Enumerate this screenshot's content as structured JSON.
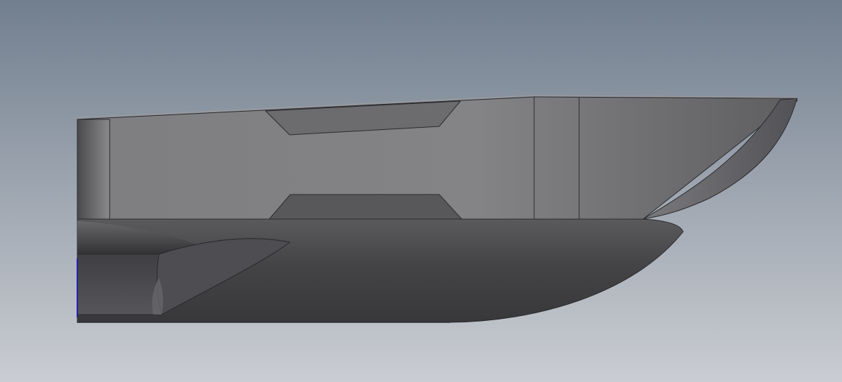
{
  "viewport": {
    "background_top": "#727f8f",
    "background_bottom": "#cacdd2"
  },
  "model": {
    "body_color": "#7b7b7d",
    "body_dark": "#3c3c3f",
    "edge_color": "#2a2a2c",
    "axis_color": "#2222a8"
  }
}
